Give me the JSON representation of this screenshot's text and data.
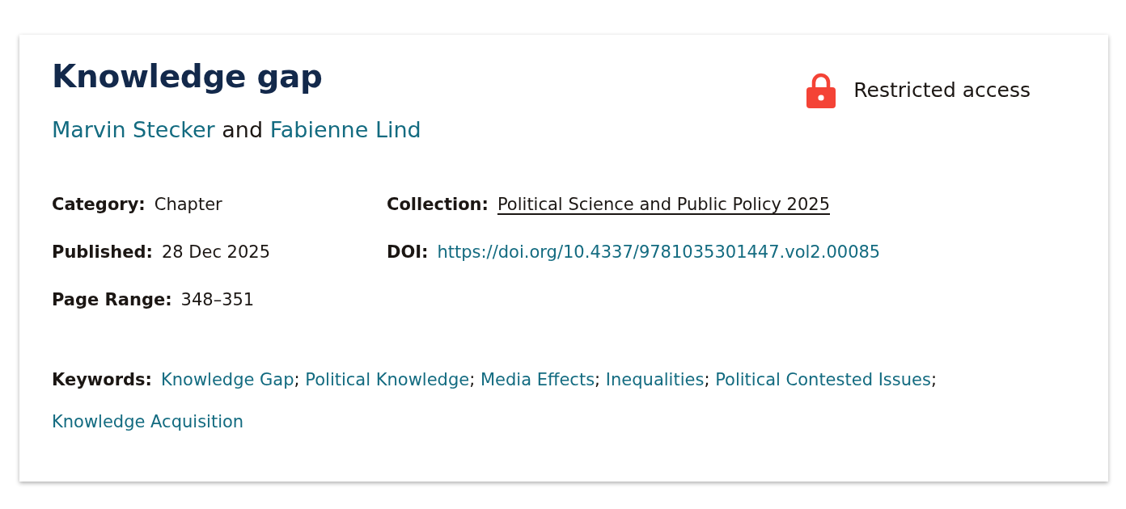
{
  "record": {
    "title": "Knowledge gap",
    "authors": [
      {
        "name": "Marvin Stecker"
      },
      {
        "name": "Fabienne Lind"
      }
    ],
    "authors_joiner": "and",
    "access": {
      "label": "Restricted access",
      "restricted": true
    }
  },
  "details": {
    "column_1": [
      {
        "label": "Category:",
        "value": "Chapter",
        "kind": "text"
      },
      {
        "label": "Published:",
        "value": "28 Dec 2025",
        "kind": "text"
      },
      {
        "label": "Page Range:",
        "value": "348–351",
        "kind": "text"
      }
    ],
    "column_2": [
      {
        "label": "Collection:",
        "value": "Political Science and Public Policy 2025",
        "kind": "plain-link"
      },
      {
        "label": "DOI:",
        "value": "https://doi.org/10.4337/9781035301447.vol2.00085",
        "kind": "link"
      }
    ]
  },
  "keywords": {
    "label": "Keywords:",
    "separator": ";",
    "items": [
      "Knowledge Gap",
      "Political Knowledge",
      "Media Effects",
      "Inequalities",
      "Political Contested Issues",
      "Knowledge Acquisition"
    ]
  }
}
